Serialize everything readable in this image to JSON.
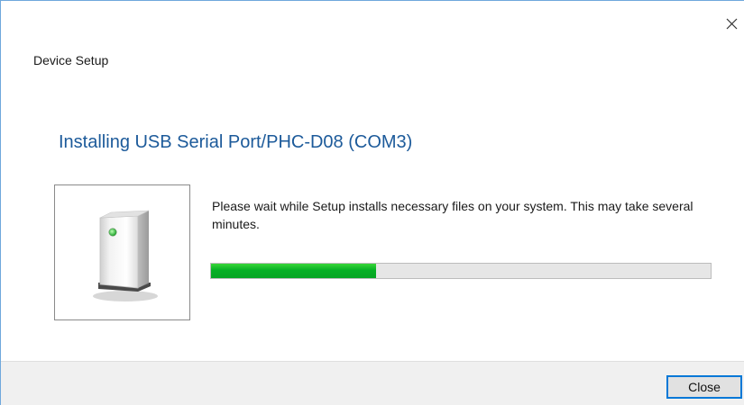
{
  "window": {
    "title": "Device Setup",
    "close_icon": "close-icon"
  },
  "main": {
    "heading": "Installing USB Serial Port/PHC-D08 (COM3)",
    "device_icon": "external-drive-icon",
    "message": "Please wait while Setup installs necessary files on your system. This may take several minutes.",
    "progress_percent": 33
  },
  "footer": {
    "close_label": "Close"
  },
  "colors": {
    "heading": "#1c5a9a",
    "progress": "#06b025",
    "accent": "#0078d7"
  }
}
